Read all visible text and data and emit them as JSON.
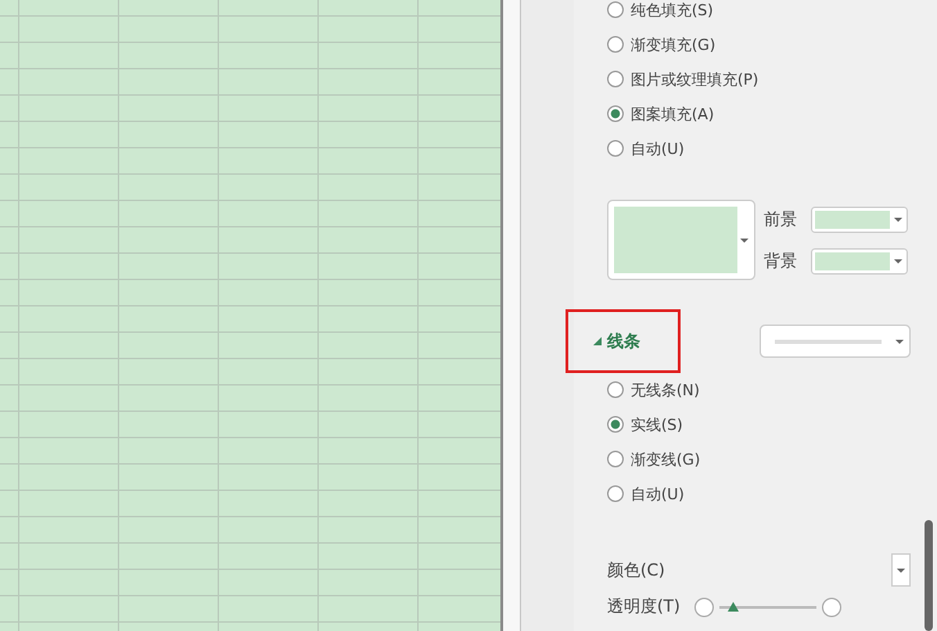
{
  "fill_options": [
    {
      "label": "纯色填充(S)",
      "selected": false
    },
    {
      "label": "渐变填充(G)",
      "selected": false
    },
    {
      "label": "图片或纹理填充(P)",
      "selected": false
    },
    {
      "label": "图案填充(A)",
      "selected": true
    },
    {
      "label": "自动(U)",
      "selected": false
    }
  ],
  "pattern": {
    "foreground_label": "前景",
    "background_label": "背景"
  },
  "line_section": {
    "title": "线条",
    "expanded": true,
    "highlighted": true
  },
  "line_options": [
    {
      "label": "无线条(N)",
      "selected": false
    },
    {
      "label": "实线(S)",
      "selected": true
    },
    {
      "label": "渐变线(G)",
      "selected": false
    },
    {
      "label": "自动(U)",
      "selected": false
    }
  ],
  "color_label": "颜色(C)",
  "transparency": {
    "label": "透明度(T)",
    "level": 0.15
  }
}
